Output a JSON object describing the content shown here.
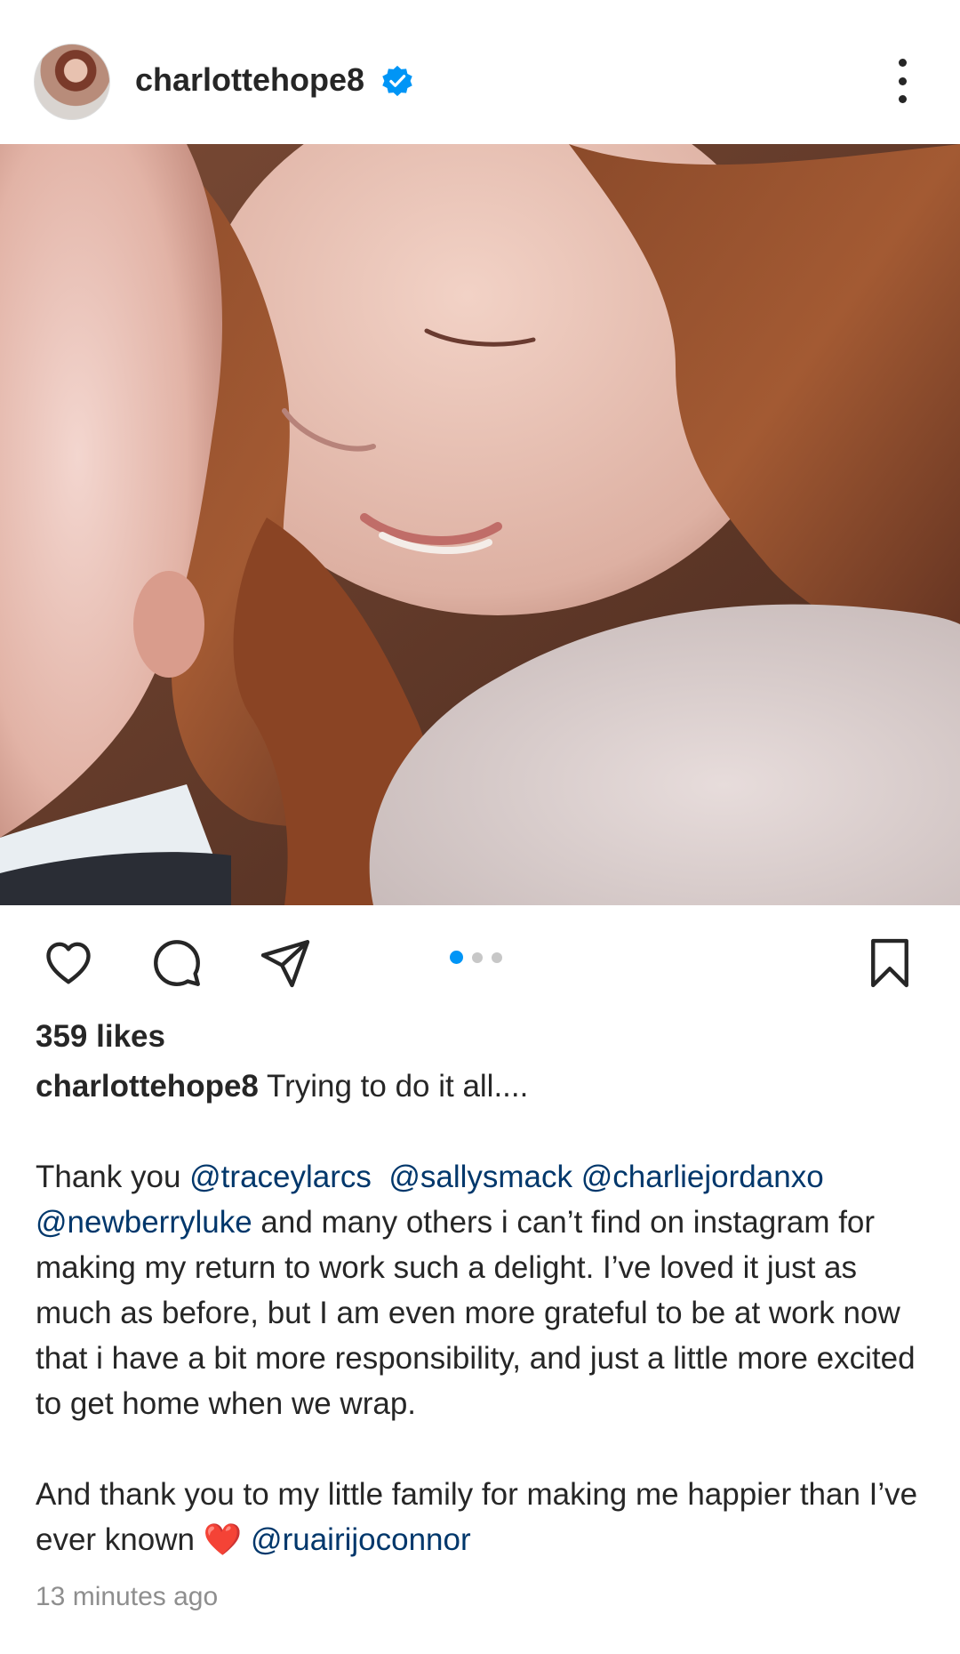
{
  "header": {
    "username": "charlottehope8",
    "verified": true,
    "avatar_icon": "profile-avatar",
    "more_icon": "more-vertical-icon"
  },
  "post": {
    "image_description_icon": "photo",
    "carousel": {
      "count": 3,
      "active_index": 0
    }
  },
  "actions": {
    "like_icon": "heart-icon",
    "comment_icon": "comment-icon",
    "share_icon": "share-icon",
    "save_icon": "bookmark-icon"
  },
  "likes": "359 likes",
  "caption": {
    "username": "charlottehope8",
    "line1": "Trying to do it all....",
    "para2": {
      "t1": "Thank you ",
      "m1": "@traceylarcs",
      "t2": "  ",
      "m2": "@sallysmack",
      "t3": " ",
      "m3": "@charliejordanxo",
      "t4": " ",
      "m4": "@newberryluke",
      "t5": " and many others i can’t find on instagram for making my return to work such a delight. I’ve loved it just as much as before, but I am even more grateful to be at work now that i have a bit more responsibility, and just a little more excited to get home when we wrap."
    },
    "para3": {
      "t1": "And thank you to my little family for making me happier than I’ve ever known ",
      "emoji": "❤️",
      "t2": " ",
      "m1": "@ruairijoconnor"
    }
  },
  "timestamp": "13 minutes ago",
  "colors": {
    "mention": "#00376b",
    "accent": "#0095f6",
    "text": "#262626",
    "muted": "#8e8e8e"
  }
}
